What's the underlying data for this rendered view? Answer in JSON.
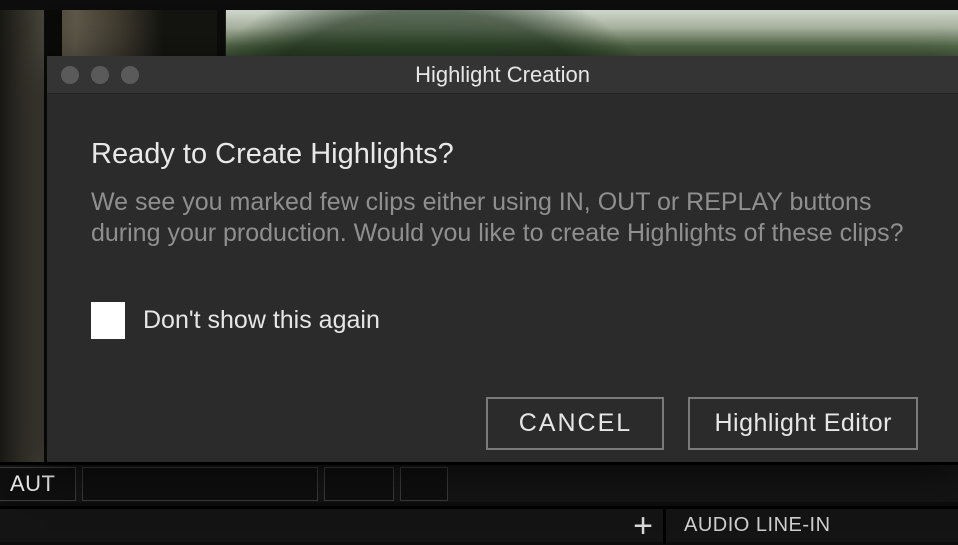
{
  "dialog": {
    "title": "Highlight Creation",
    "heading": "Ready to Create Highlights?",
    "body": "We see you marked few clips either using IN, OUT or REPLAY buttons during your production. Would you like to create Highlights of these clips?",
    "dont_show_label": "Don't show this again",
    "cancel_label": "CANCEL",
    "editor_label": "Highlight Editor"
  },
  "bottom": {
    "aut_label": "AUT",
    "audio_label": "AUDIO LINE-IN",
    "plus_glyph": "+"
  }
}
